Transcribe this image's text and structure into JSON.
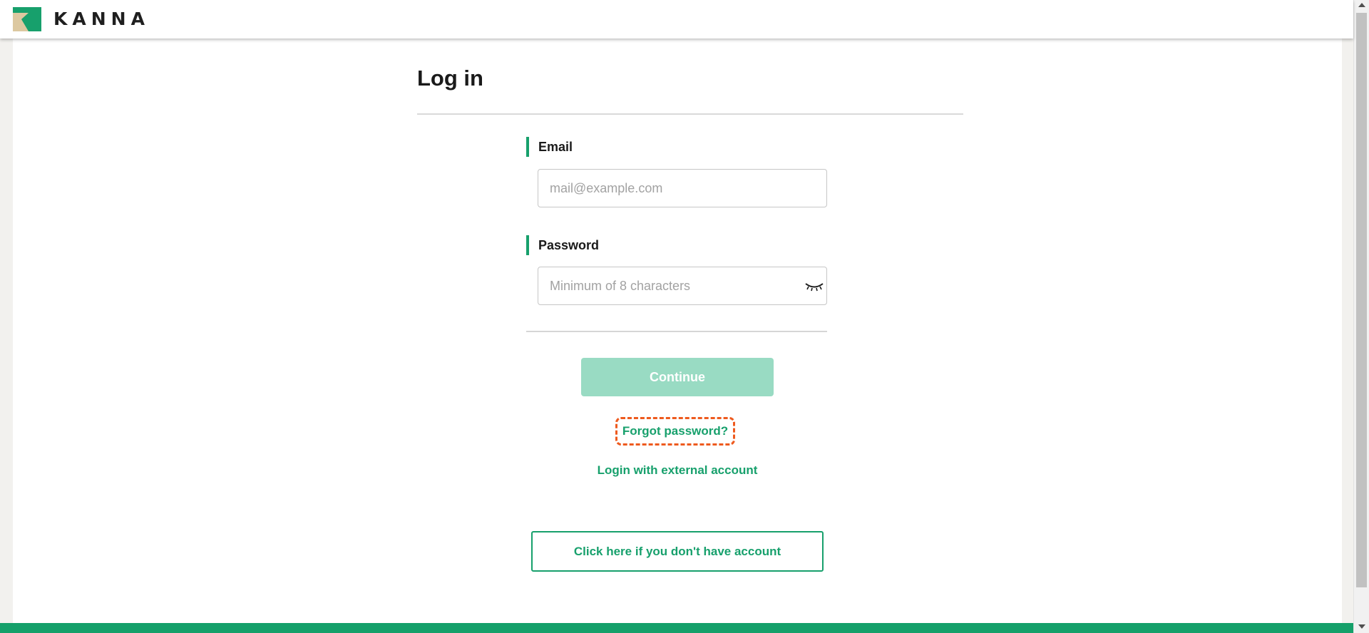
{
  "header": {
    "logo_icon": "kanna-logo-icon",
    "logo_text": "KANNA"
  },
  "page": {
    "title": "Log in"
  },
  "form": {
    "email_label": "Email",
    "email_placeholder": "mail@example.com",
    "email_value": "",
    "password_label": "Password",
    "password_placeholder": "Minimum of 8 characters",
    "password_value": "",
    "password_toggle_icon": "eye-closed-icon",
    "continue_label": "Continue",
    "forgot_password_label": "Forgot password?",
    "external_login_label": "Login with external account",
    "signup_label": "Click here if you don't have account"
  },
  "colors": {
    "accent": "#17a06c",
    "accent_disabled": "#99dbc3",
    "focus_outline": "#ee5a1e",
    "logo_tan": "#dcc8a0"
  }
}
